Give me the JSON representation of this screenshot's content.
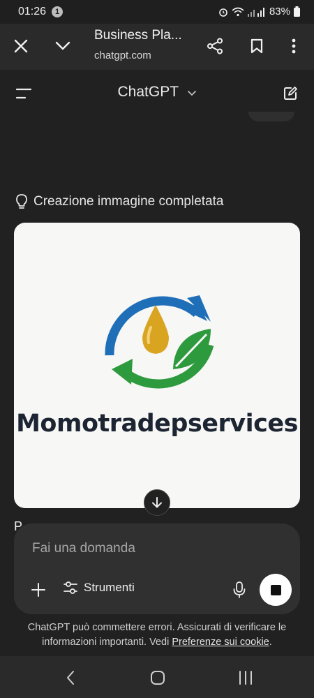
{
  "status_bar": {
    "time": "01:26",
    "notification_count": "1",
    "battery": "83%",
    "icons": [
      "alarm-icon",
      "wifi-icon",
      "signal-icon",
      "battery-icon"
    ]
  },
  "browser": {
    "title": "Business Pla...",
    "url": "chatgpt.com"
  },
  "chat": {
    "title": "ChatGPT",
    "status_text": "Creazione immagine completata",
    "image_logo_text": "Momotradepservices",
    "partial_text": "P"
  },
  "composer": {
    "placeholder": "Fai una domanda",
    "tools_label": "Strumenti"
  },
  "disclaimer": {
    "text": "ChatGPT può commettere errori. Assicurati di verificare le informazioni importanti. Vedi ",
    "link": "Preferenze sui cookie",
    "end": "."
  },
  "colors": {
    "background": "#212121",
    "composer": "#303030",
    "logo_blue": "#1f6fb8",
    "logo_green": "#2e9a3e",
    "logo_drop": "#d9a420"
  }
}
